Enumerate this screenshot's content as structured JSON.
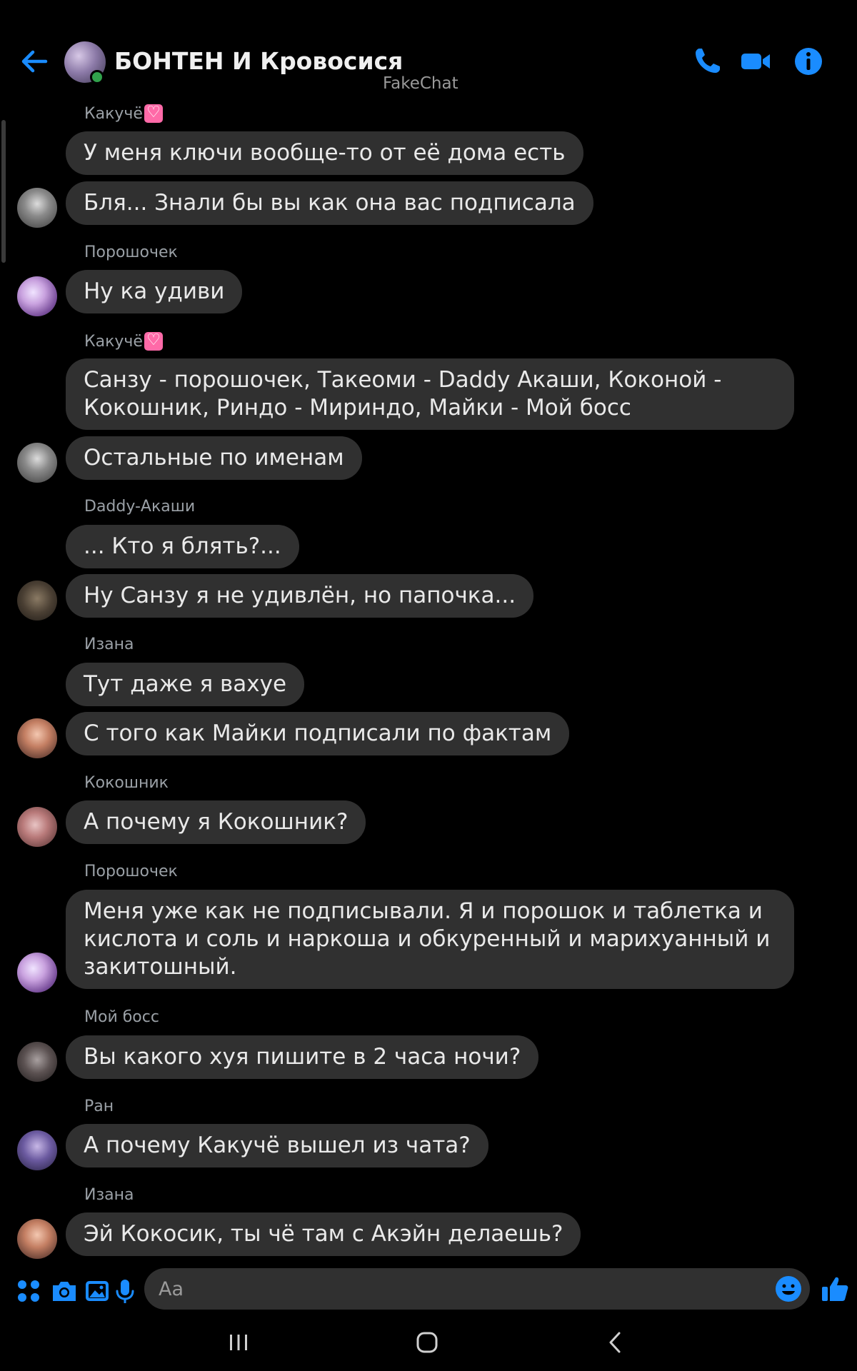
{
  "header": {
    "title": "БОНТЕН И Кровосися",
    "watermark": "FakeChat",
    "accent": "#1a8cff"
  },
  "messages": [
    {
      "sender": "Какучё",
      "sender_emoji": "heart",
      "bubbles": [
        "У меня ключи вообще-то от её дома есть",
        "Бля... Знали бы вы как она вас подписала"
      ]
    },
    {
      "sender": "Порошочек",
      "bubbles": [
        "Ну ка удиви"
      ]
    },
    {
      "sender": "Какучё",
      "sender_emoji": "heart",
      "bubbles": [
        "Санзу - порошочек, Такеоми - Daddy Акаши, Коконой - Кокошник, Риндо - Мириндо, Майки - Мой босс",
        "Остальные по именам"
      ]
    },
    {
      "sender": "Daddy-Акаши",
      "bubbles": [
        "... Кто я блять?...",
        "Ну Санзу я не удивлён, но папочка..."
      ]
    },
    {
      "sender": "Изана",
      "bubbles": [
        "Тут даже я вахуе",
        "С того как Майки подписали по фактам"
      ]
    },
    {
      "sender": "Кокошник",
      "bubbles": [
        "А почему я Кокошник?"
      ]
    },
    {
      "sender": "Порошочек",
      "bubbles": [
        "Меня уже как не подписывали. Я и порошок и таблетка и кислота и соль и наркоша и обкуренный и марихуанный и закитошный."
      ]
    },
    {
      "sender": "Мой босс",
      "bubbles": [
        "Вы какого хуя пишите в 2 часа ночи?"
      ]
    },
    {
      "sender": "Ран",
      "bubbles": [
        "А почему Какучё вышел из чата?"
      ]
    },
    {
      "sender": "Изана",
      "bubbles": [
        "Эй Кокосик, ты чё там с Акэйн делаешь?"
      ]
    }
  ],
  "composer": {
    "placeholder": "Aa"
  },
  "icons": {
    "back": "arrow-left-icon",
    "call": "phone-icon",
    "video": "video-camera-icon",
    "info": "info-icon",
    "apps": "apps-grid-icon",
    "camera": "camera-icon",
    "gallery": "image-icon",
    "mic": "microphone-icon",
    "emoji": "emoji-icon",
    "like": "thumbs-up-icon"
  }
}
